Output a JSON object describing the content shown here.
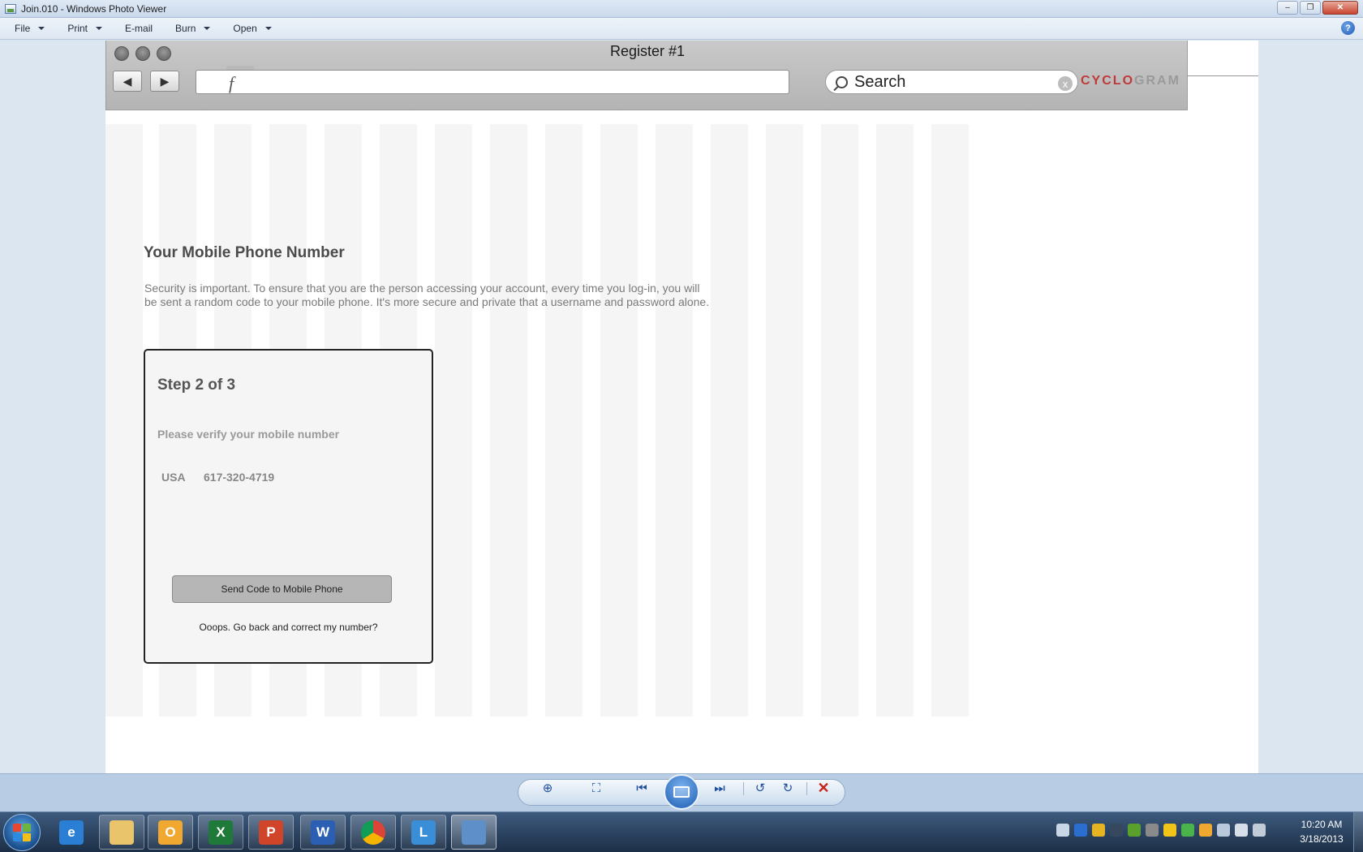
{
  "window": {
    "title": "Join.010 - Windows Photo Viewer",
    "controls": {
      "minimize": "–",
      "maximize": "❐",
      "close": "✕"
    }
  },
  "menu": {
    "items": [
      {
        "label": "File",
        "has_dropdown": true
      },
      {
        "label": "Print",
        "has_dropdown": true
      },
      {
        "label": "E-mail",
        "has_dropdown": false
      },
      {
        "label": "Burn",
        "has_dropdown": true
      },
      {
        "label": "Open",
        "has_dropdown": true
      }
    ],
    "help_icon": "?"
  },
  "mockup": {
    "window_title": "Register #1",
    "url_glyph": "f",
    "search_placeholder": "Search",
    "search_clear": "x",
    "brand_part1": "CYCL",
    "brand_mark": "O",
    "brand_part2": "GRAM",
    "brand_color": "#c03a3a",
    "page": {
      "heading": "Your Mobile Phone Number",
      "intro": "Security is important.  To ensure that you are the person accessing your account, every time you log-in, you will be sent a random code to your mobile phone.  It's more secure and private that a username and password alone.",
      "step": {
        "title": "Step 2 of 3",
        "subtitle": "Please verify your mobile number",
        "country": "USA",
        "phone": "617-320-4719",
        "send_button": "Send Code to Mobile Phone",
        "back_link": "Ooops. Go back and correct my number?"
      }
    }
  },
  "viewer_controls": [
    {
      "icon": "zoom-icon",
      "glyph": "⊕"
    },
    {
      "icon": "actual-size-icon",
      "glyph": "⛶"
    },
    {
      "icon": "previous-icon",
      "glyph": "⏮"
    },
    {
      "icon": "slideshow-icon",
      "glyph": ""
    },
    {
      "icon": "next-icon",
      "glyph": "⏭"
    },
    {
      "icon": "rotate-left-icon",
      "glyph": "↺"
    },
    {
      "icon": "rotate-right-icon",
      "glyph": "↻"
    },
    {
      "icon": "delete-icon",
      "glyph": "✕"
    }
  ],
  "taskbar": {
    "apps": [
      {
        "name": "internet-explorer",
        "glyph": "e",
        "color": "#2a7fd4"
      },
      {
        "name": "windows-explorer",
        "glyph": "",
        "color": "#e9c46a"
      },
      {
        "name": "outlook",
        "glyph": "O",
        "color": "#f0a830"
      },
      {
        "name": "excel",
        "glyph": "X",
        "color": "#1f7a3a"
      },
      {
        "name": "powerpoint",
        "glyph": "P",
        "color": "#d0442a"
      },
      {
        "name": "word",
        "glyph": "W",
        "color": "#2b5fb4"
      },
      {
        "name": "chrome",
        "glyph": "",
        "color": "#4caf50"
      },
      {
        "name": "lync",
        "glyph": "L",
        "color": "#3a8ed8"
      },
      {
        "name": "photo-viewer",
        "glyph": "",
        "color": "#5f8fc8"
      }
    ],
    "time": "10:20 AM",
    "date": "3/18/2013"
  }
}
